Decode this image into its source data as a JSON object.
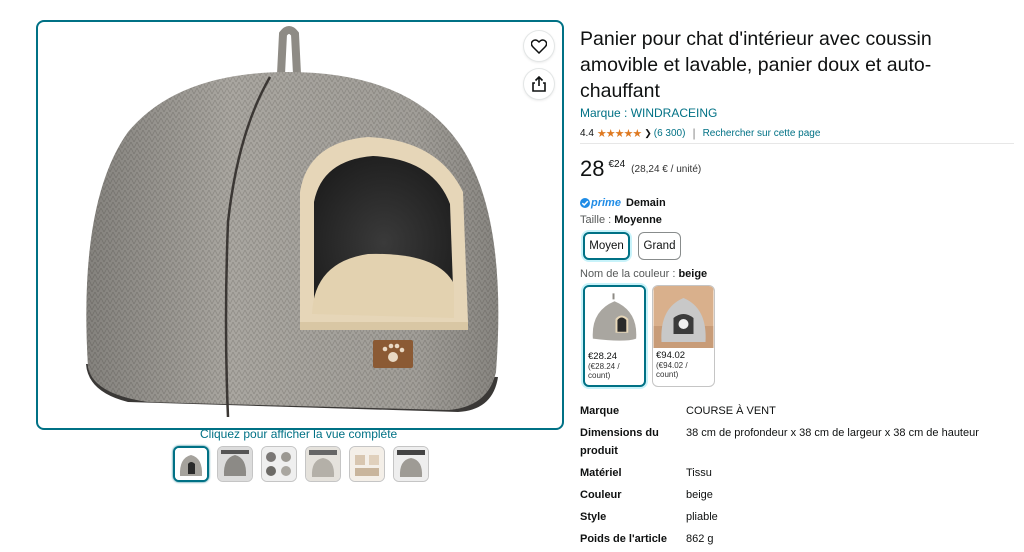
{
  "gallery": {
    "full_view_link": "Cliquez pour afficher la vue complète",
    "selected_thumb": 0,
    "thumbnails": [
      "thumb-1",
      "thumb-2",
      "thumb-3",
      "thumb-4",
      "thumb-5",
      "thumb-6"
    ]
  },
  "product": {
    "title": "Panier pour chat d'intérieur avec coussin amovible et lavable, panier doux et auto-chauffant",
    "brand_link": "Marque : WINDRACEING",
    "rating_value": "4.4",
    "rating_stars": "★★★★★",
    "rating_count": "(6 300)",
    "search_page_link": "Rechercher sur cette page"
  },
  "price": {
    "whole": "28",
    "fraction": "€24",
    "unit_price": "(28,24 € / unité)"
  },
  "delivery": {
    "prime_label": "prime",
    "delivery_day": "Demain"
  },
  "size": {
    "label": "Taille : ",
    "selected": "Moyenne",
    "options": [
      "Moyen",
      "Grand"
    ]
  },
  "color": {
    "label": "Nom de la couleur : ",
    "selected": "beige",
    "options": [
      {
        "price": "€28.24",
        "unit": "(€28.24 /",
        "unit2": "count)"
      },
      {
        "price": "€94.02",
        "unit": "(€94.02 /",
        "unit2": "count)"
      }
    ]
  },
  "specs": [
    {
      "key": "Marque",
      "value": "COURSE À VENT"
    },
    {
      "key": "Dimensions du produit",
      "value": "38 cm de profondeur x 38 cm de largeur x 38 cm de hauteur"
    },
    {
      "key": "Matériel",
      "value": "Tissu"
    },
    {
      "key": "Couleur",
      "value": "beige"
    },
    {
      "key": "Style",
      "value": "pliable"
    },
    {
      "key": "Poids de l'article",
      "value": "862 g"
    }
  ],
  "colors": {
    "link": "#007185",
    "star": "#de7921",
    "prime": "#1f8ce6",
    "selected_border": "#007185"
  }
}
